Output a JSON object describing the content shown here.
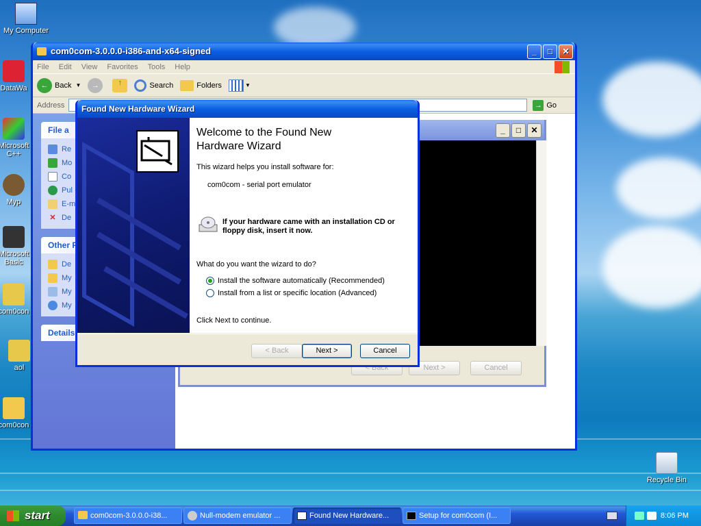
{
  "desktop": {
    "icons": [
      {
        "label": "My Computer"
      },
      {
        "label": "DataWa"
      },
      {
        "label": "Microsoft C++"
      },
      {
        "label": "Myp"
      },
      {
        "label": "Microsoft Basic"
      },
      {
        "label": "com0con"
      },
      {
        "label": "aol"
      },
      {
        "label": "com0con"
      },
      {
        "label": "Recycle Bin"
      }
    ]
  },
  "explorer": {
    "title": "com0com-3.0.0.0-i386-and-x64-signed",
    "menu": [
      "File",
      "Edit",
      "View",
      "Favorites",
      "Tools",
      "Help"
    ],
    "toolbar": {
      "back": "Back",
      "search": "Search",
      "folders": "Folders"
    },
    "address_label": "Address",
    "go_label": "Go",
    "panels": [
      {
        "title": "File a",
        "items": [
          "Re",
          "Mo",
          "Co",
          "Pul",
          "E-m",
          "De"
        ]
      },
      {
        "title": "Other P",
        "items": [
          "De",
          "My",
          "My",
          "My"
        ]
      },
      {
        "title": "Details"
      }
    ]
  },
  "setup_window": {
    "buttons": [
      "< Back",
      "Next >",
      "Cancel"
    ]
  },
  "wizard": {
    "title": "Found New Hardware Wizard",
    "heading": "Welcome to the Found New Hardware Wizard",
    "intro": "This wizard helps you install software for:",
    "device": "com0com - serial port emulator",
    "cd_notice": "If your hardware came with an installation CD or floppy disk, insert it now.",
    "question": "What do you want the wizard to do?",
    "options": [
      {
        "label": "Install the software automatically (Recommended)",
        "selected": true
      },
      {
        "label": "Install from a list or specific location (Advanced)",
        "selected": false
      }
    ],
    "footer": "Click Next to continue.",
    "back_label": "< Back",
    "next_label": "Next >",
    "cancel_label": "Cancel"
  },
  "taskbar": {
    "start_label": "start",
    "tasks": [
      {
        "label": "com0com-3.0.0.0-i38..."
      },
      {
        "label": "Null-modem emulator ..."
      },
      {
        "label": "Found New Hardware..."
      },
      {
        "label": "Setup for com0com (I..."
      }
    ],
    "clock": "8:06 PM"
  }
}
